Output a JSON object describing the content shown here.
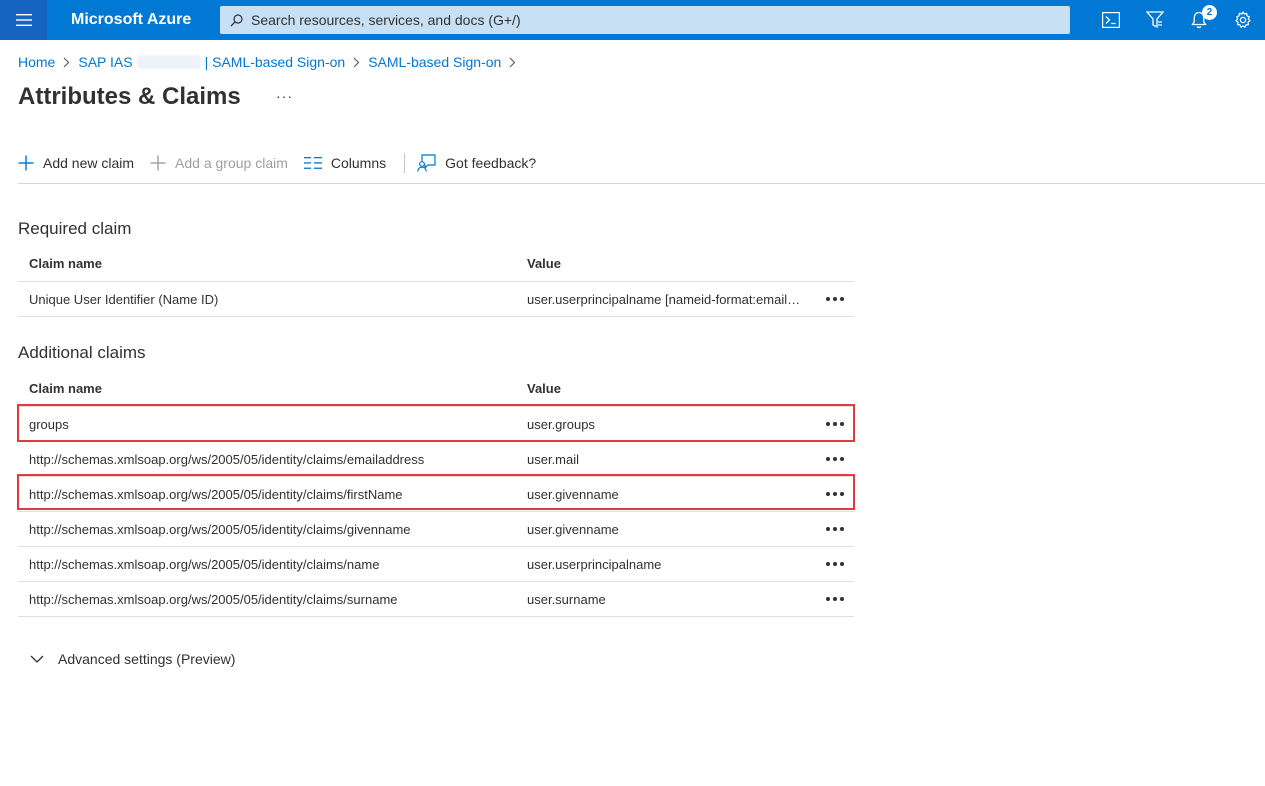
{
  "header": {
    "brand": "Microsoft Azure",
    "search_placeholder": "Search resources, services, and docs (G+/)",
    "notification_count": "2",
    "accent_color": "#0078d4"
  },
  "breadcrumb": {
    "home": "Home",
    "app_prefix": "SAP IAS",
    "app_suffix": "| SAML-based Sign-on",
    "sso": "SAML-based Sign-on"
  },
  "page": {
    "title": "Attributes & Claims",
    "more": "···"
  },
  "toolbar": {
    "add_new_claim": "Add new claim",
    "add_group_claim": "Add a group claim",
    "columns": "Columns",
    "feedback": "Got feedback?"
  },
  "required": {
    "title": "Required claim",
    "col_name": "Claim name",
    "col_value": "Value",
    "rows": [
      {
        "name": "Unique User Identifier (Name ID)",
        "value": "user.userprincipalname [nameid-format:emailAddress]"
      }
    ]
  },
  "additional": {
    "title": "Additional claims",
    "col_name": "Claim name",
    "col_value": "Value",
    "rows": [
      {
        "name": "groups",
        "value": "user.groups",
        "highlighted": true
      },
      {
        "name": "http://schemas.xmlsoap.org/ws/2005/05/identity/claims/emailaddress",
        "value": "user.mail",
        "highlighted": false
      },
      {
        "name": "http://schemas.xmlsoap.org/ws/2005/05/identity/claims/firstName",
        "value": "user.givenname",
        "highlighted": true
      },
      {
        "name": "http://schemas.xmlsoap.org/ws/2005/05/identity/claims/givenname",
        "value": "user.givenname",
        "highlighted": false
      },
      {
        "name": "http://schemas.xmlsoap.org/ws/2005/05/identity/claims/name",
        "value": "user.userprincipalname",
        "highlighted": false
      },
      {
        "name": "http://schemas.xmlsoap.org/ws/2005/05/identity/claims/surname",
        "value": "user.surname",
        "highlighted": false
      }
    ]
  },
  "advanced": {
    "label": "Advanced settings (Preview)"
  },
  "icons": [
    "hamburger-icon",
    "search-icon",
    "cloud-shell-icon",
    "directory-filter-icon",
    "bell-icon",
    "gear-icon",
    "plus-icon",
    "columns-icon",
    "feedback-icon",
    "chevron-right-icon",
    "chevron-down-icon",
    "more-icon"
  ],
  "highlight_color": "#e0393e"
}
